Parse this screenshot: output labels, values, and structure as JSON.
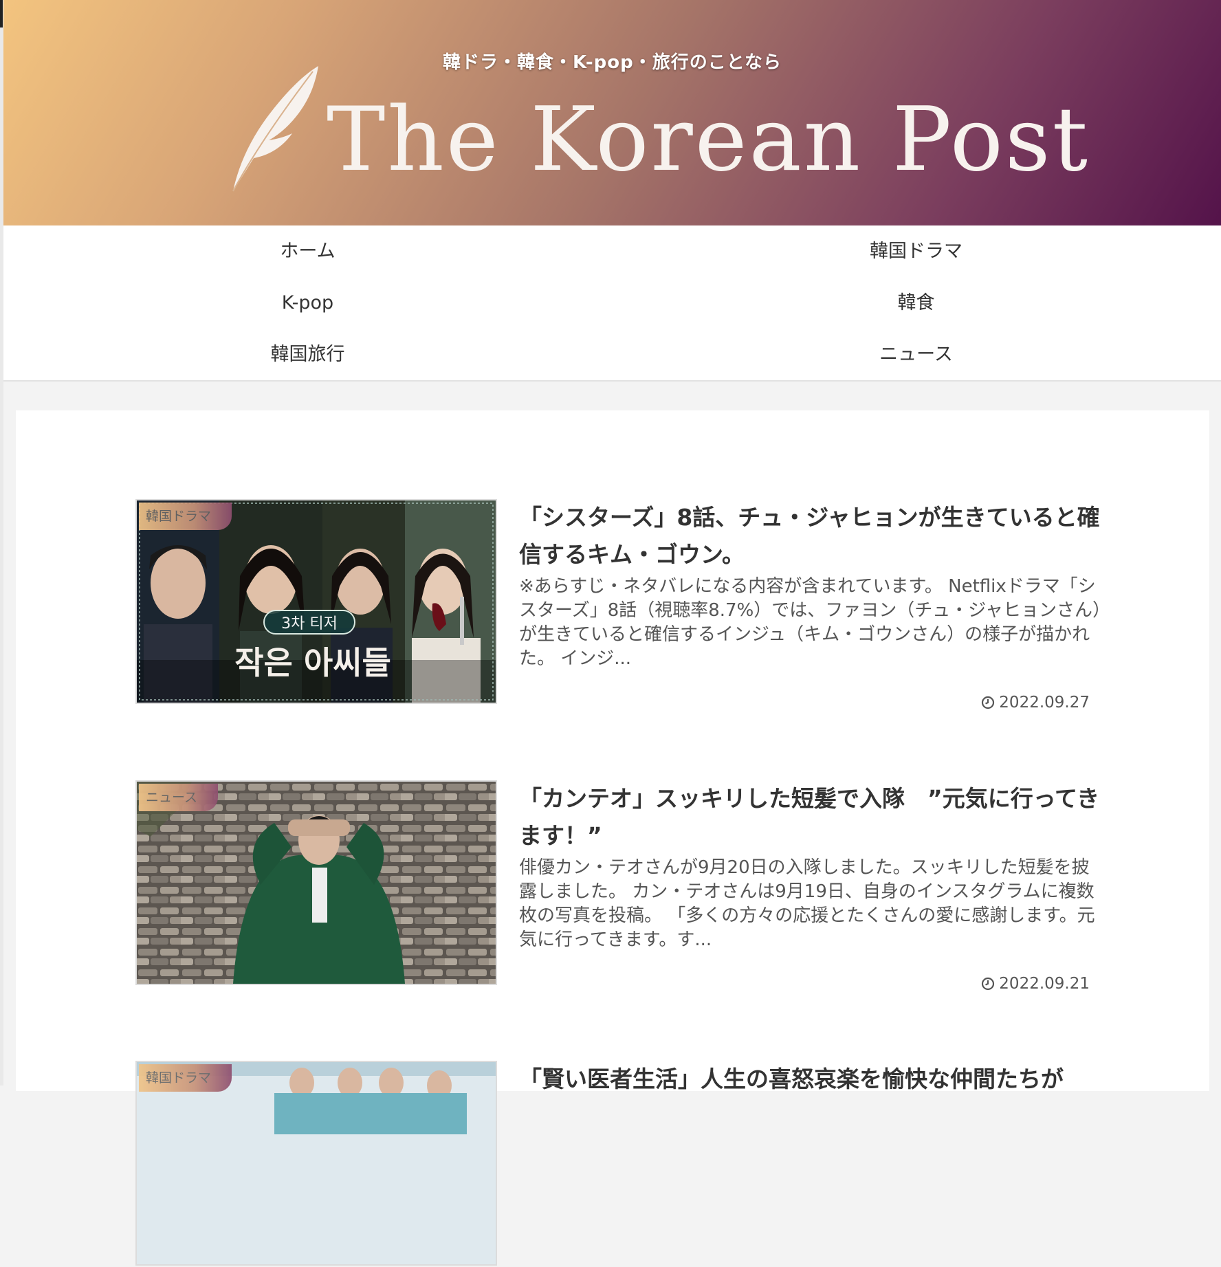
{
  "site": {
    "tagline": "韓ドラ・韓食・K-pop・旅行のことなら",
    "logo_text": "The Korean Post",
    "gradient_colors": [
      "#f3c47f",
      "#a57468",
      "#54134a"
    ]
  },
  "nav": {
    "items": [
      {
        "label": "ホーム"
      },
      {
        "label": "韓国ドラマ"
      },
      {
        "label": "K-pop"
      },
      {
        "label": "韓食"
      },
      {
        "label": "韓国旅行"
      },
      {
        "label": "ニュース"
      }
    ]
  },
  "posts": [
    {
      "category": "韓国ドラマ",
      "title": "「シスターズ」8話、チュ・ジャヒョンが生きていると確信するキム・ゴウン。",
      "snippet": "※あらすじ・ネタバレになる内容が含まれています。 Netflixドラマ「シスターズ」8話（視聴率8.7%）では、ファヨン（チュ・ジャヒョンさん）が生きていると確信するインジュ（キム・ゴウンさん）の様子が描かれた。 インジ...",
      "date": "2022.09.27",
      "thumb_badge": "3차 티저",
      "thumb_title": "작은 아씨들"
    },
    {
      "category": "ニュース",
      "title": "「カンテオ」スッキリした短髪で入隊　”元気に行ってきます！”",
      "snippet": "俳優カン・テオさんが9月20日の入隊しました。スッキリした短髪を披露しました。 カン・テオさんは9月19日、自身のインスタグラムに複数枚の写真を投稿。 「多くの方々の応援とたくさんの愛に感謝します。元気に行ってきます。す...",
      "date": "2022.09.21"
    },
    {
      "category": "韓国ドラマ",
      "title": "「賢い医者生活」人生の喜怒哀楽を愉快な仲間たちが"
    }
  ],
  "icons": {
    "date_icon": "clock-icon",
    "logo_icon": "feather-icon"
  }
}
